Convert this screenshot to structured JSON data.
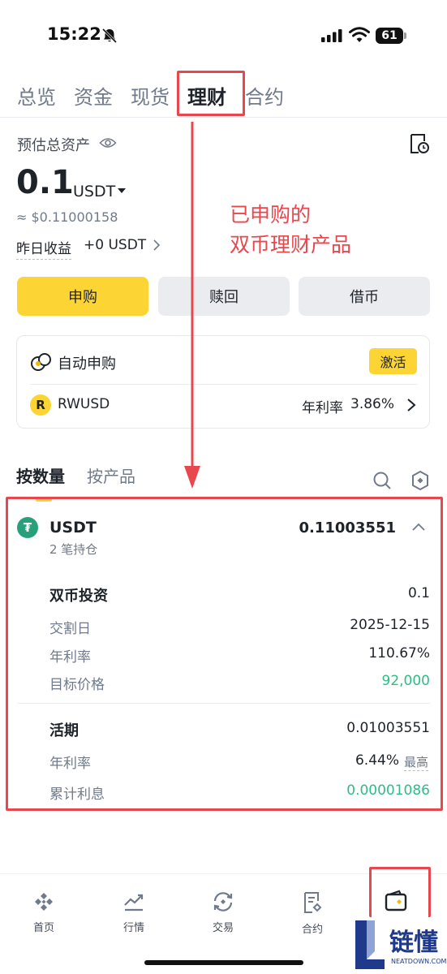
{
  "status": {
    "time": "15:22",
    "battery": "61"
  },
  "top_tabs": [
    "总览",
    "资金",
    "现货",
    "理财",
    "合约"
  ],
  "active_tab_index": 3,
  "assets": {
    "title": "预估总资产",
    "amount": "0.1",
    "unit": "USDT",
    "usd_value": "≈ $0.11000158",
    "yesterday_label": "昨日收益",
    "yesterday_value": "+0 USDT"
  },
  "annotation": [
    "已申购的",
    "双币理财产品"
  ],
  "buttons": {
    "subscribe": "申购",
    "redeem": "赎回",
    "borrow": "借币"
  },
  "auto": {
    "title": "自动申购",
    "activate": "激活",
    "coin": "RWUSD",
    "apr_label": "年利率",
    "apr_value": "3.86%"
  },
  "sub_tabs": [
    "按数量",
    "按产品"
  ],
  "position": {
    "coin": "USDT",
    "count": "2 笔持仓",
    "total": "0.11003551",
    "dual": {
      "title": "双币投资",
      "amount": "0.1",
      "settle_label": "交割日",
      "settle_value": "2025-12-15",
      "apr_label": "年利率",
      "apr_value": "110.67%",
      "target_label": "目标价格",
      "target_value": "92,000"
    },
    "flexible": {
      "title": "活期",
      "amount": "0.01003551",
      "apr_label": "年利率",
      "apr_value": "6.44%",
      "apr_tag": "最高",
      "interest_label": "累计利息",
      "interest_value": "0.00001086"
    }
  },
  "bottom_nav": [
    "首页",
    "行情",
    "交易",
    "合约"
  ],
  "watermark": {
    "brand": "链懂",
    "url": "NEATDOWN.COM"
  },
  "colors": {
    "accent": "#fcd535",
    "red": "#e8474d",
    "green": "#2ebd85",
    "teal": "#26a17b"
  }
}
